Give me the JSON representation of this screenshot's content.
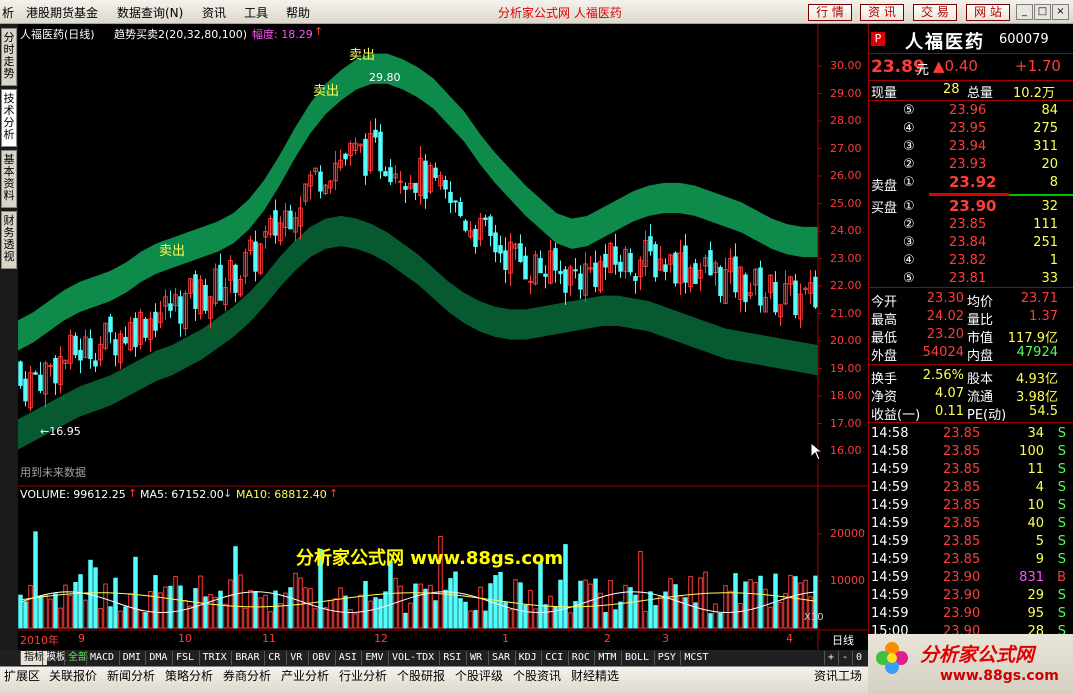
{
  "menu": {
    "items": [
      "析",
      "港股期货基金",
      "数据查询(N)",
      "资讯",
      "工具",
      "帮助"
    ],
    "app_title": "分析家公式网  人福医药",
    "buttons": [
      "行 情",
      "资 讯",
      "交 易",
      "网 站"
    ],
    "window_controls": [
      "_",
      "□",
      "×"
    ]
  },
  "left_tabs": [
    "分时走势",
    "技术分析",
    "基本资料",
    "财务透视"
  ],
  "chart": {
    "header_name": "人福医药(日线)",
    "indicator": "趋势买卖2(20,32,80,100)",
    "range_label": "幅度: 18.29",
    "range_arrow": "↑",
    "future_label": "用到未来数据",
    "sell_labels": [
      "卖出",
      "卖出",
      "卖出"
    ],
    "high_mark": "29.80",
    "low_mark": "←16.95",
    "watermark": "分析家公式网  www.88gs.com",
    "volume_label": "VOLUME: 99612.25",
    "ma5_label": "MA5: 67152.00",
    "ma10_label": "MA10: 68812.40",
    "arrow_up": "↑",
    "arrow_down": "↓",
    "x10_label": "X10",
    "period_label": "日线",
    "date_labels": [
      "2010年",
      "9",
      "10",
      "11",
      "12",
      "1",
      "2",
      "3",
      "4"
    ],
    "colors": {
      "up": "#ff3c3c",
      "down": "#54fcfc",
      "band": "#0e8a4a",
      "band_dark": "#075a30",
      "axis": "#a00000"
    }
  },
  "chart_data": {
    "type": "candlestick",
    "price_axis": [
      30,
      29,
      28,
      27,
      26,
      25,
      24,
      23,
      22,
      21,
      20,
      19,
      18,
      17,
      16
    ],
    "price_tick_labels": [
      "30.00",
      "29.00",
      "28.00",
      "27.00",
      "26.00",
      "25.00",
      "24.00",
      "23.00",
      "22.00",
      "21.00",
      "20.00",
      "19.00",
      "18.00",
      "17.00",
      "16.00"
    ],
    "volume_ticks": [
      20000,
      10000
    ],
    "volume_tick_labels": [
      "20000",
      "10000"
    ],
    "ylim": [
      15.5,
      30.5
    ],
    "upper_band": [
      20.2,
      20.5,
      20.9,
      21.3,
      21.6,
      21.8,
      22.0,
      22.3,
      22.7,
      23.0,
      23.2,
      23.4,
      23.6,
      23.8,
      24.1,
      24.6,
      25.3,
      26.2,
      27.2,
      28.1,
      28.8,
      29.3,
      29.7,
      29.9,
      29.9,
      29.7,
      29.4,
      29.0,
      28.4,
      27.8,
      27.0,
      26.3,
      25.7,
      25.1,
      24.6,
      24.1,
      23.9,
      24.0,
      24.3,
      24.6,
      24.9,
      25.1,
      25.2,
      25.2,
      25.1,
      24.9,
      24.7,
      24.5,
      24.2,
      23.9,
      23.7,
      23.6,
      23.6
    ],
    "lower_band": [
      16.6,
      16.9,
      17.2,
      17.5,
      17.8,
      18.0,
      18.2,
      18.5,
      18.8,
      19.1,
      19.3,
      19.6,
      19.9,
      20.3,
      20.7,
      21.2,
      21.8,
      22.5,
      23.1,
      23.6,
      23.9,
      24.0,
      23.9,
      23.7,
      23.4,
      23.0,
      22.6,
      22.1,
      21.6,
      21.2,
      20.9,
      20.7,
      20.6,
      20.6,
      20.7,
      20.8,
      20.9,
      21.0,
      21.1,
      21.1,
      21.0,
      20.9,
      20.7,
      20.5,
      20.3,
      20.1,
      19.9,
      19.8,
      19.7,
      19.6,
      19.5,
      19.4,
      19.3
    ]
  },
  "quote": {
    "tag": "P",
    "name": "人福医药",
    "code": "600079",
    "price": "23.89",
    "unit": "元",
    "change": "▲0.40",
    "change_pct": "+1.70",
    "current_vol_label": "现量",
    "current_vol": "28",
    "total_vol_label": "总量",
    "total_vol": "10.2万",
    "sell_label": "卖盘",
    "buy_label": "买盘",
    "asks": [
      {
        "level": "⑤",
        "price": "23.96",
        "vol": "84"
      },
      {
        "level": "④",
        "price": "23.95",
        "vol": "275"
      },
      {
        "level": "③",
        "price": "23.94",
        "vol": "311"
      },
      {
        "level": "②",
        "price": "23.93",
        "vol": "20"
      },
      {
        "level": "①",
        "price": "23.92",
        "vol": "8"
      }
    ],
    "bids": [
      {
        "level": "①",
        "price": "23.90",
        "vol": "32"
      },
      {
        "level": "②",
        "price": "23.85",
        "vol": "111"
      },
      {
        "level": "③",
        "price": "23.84",
        "vol": "251"
      },
      {
        "level": "④",
        "price": "23.82",
        "vol": "1"
      },
      {
        "level": "⑤",
        "price": "23.81",
        "vol": "33"
      }
    ],
    "stats": [
      {
        "l1": "今开",
        "v1": "23.30",
        "c1": "#ff3c3c",
        "l2": "均价",
        "v2": "23.71",
        "c2": "#ff3c3c"
      },
      {
        "l1": "最高",
        "v1": "24.02",
        "c1": "#ff3c3c",
        "l2": "量比",
        "v2": "1.37",
        "c2": "#ff3c3c"
      },
      {
        "l1": "最低",
        "v1": "23.20",
        "c1": "#ff3c3c",
        "l2": "市值",
        "v2": "117.9亿",
        "c2": "#ffff54"
      },
      {
        "l1": "外盘",
        "v1": "54024",
        "c1": "#ff3c3c",
        "l2": "内盘",
        "v2": "47924",
        "c2": "#54fc54"
      }
    ],
    "stats2": [
      {
        "l1": "换手",
        "v1": "2.56%",
        "l2": "股本",
        "v2": "4.93亿"
      },
      {
        "l1": "净资",
        "v1": "4.07",
        "l2": "流通",
        "v2": "3.98亿"
      },
      {
        "l1": "收益(一)",
        "v1": "0.11",
        "l2": "PE(动)",
        "v2": "54.5"
      }
    ],
    "ticks": [
      {
        "time": "14:58",
        "price": "23.85",
        "vol": "34",
        "side": "S"
      },
      {
        "time": "14:58",
        "price": "23.85",
        "vol": "100",
        "side": "S"
      },
      {
        "time": "14:59",
        "price": "23.85",
        "vol": "11",
        "side": "S"
      },
      {
        "time": "14:59",
        "price": "23.85",
        "vol": "4",
        "side": "S"
      },
      {
        "time": "14:59",
        "price": "23.85",
        "vol": "10",
        "side": "S"
      },
      {
        "time": "14:59",
        "price": "23.85",
        "vol": "40",
        "side": "S"
      },
      {
        "time": "14:59",
        "price": "23.85",
        "vol": "5",
        "side": "S"
      },
      {
        "time": "14:59",
        "price": "23.85",
        "vol": "9",
        "side": "S"
      },
      {
        "time": "14:59",
        "price": "23.90",
        "vol": "831",
        "side": "B"
      },
      {
        "time": "14:59",
        "price": "23.90",
        "vol": "29",
        "side": "S"
      },
      {
        "time": "14:59",
        "price": "23.90",
        "vol": "95",
        "side": "S"
      },
      {
        "time": "15:00",
        "price": "23.90",
        "vol": "28",
        "side": "S"
      }
    ]
  },
  "func_bar": {
    "items": [
      "指标",
      "模板",
      "全部",
      "MACD",
      "DMI",
      "DMA",
      "FSL",
      "TRIX",
      "BRAR",
      "CR",
      "VR",
      "OBV",
      "ASI",
      "EMV",
      "VOL-TDX",
      "RSI",
      "WR",
      "SAR",
      "KDJ",
      "CCI",
      "ROC",
      "MTM",
      "BOLL",
      "PSY",
      "MCST"
    ],
    "controls": [
      "+",
      "-",
      "0"
    ]
  },
  "status_bar": {
    "items": [
      "扩展区",
      "关联报价",
      "新闻分析",
      "策略分析",
      "券商分析",
      "产业分析",
      "行业分析",
      "个股研报",
      "个股评级",
      "个股资讯",
      "财经精选"
    ],
    "right": "资讯工场"
  },
  "logo": {
    "text": "分析家公式网",
    "url": "www.88gs.com"
  }
}
